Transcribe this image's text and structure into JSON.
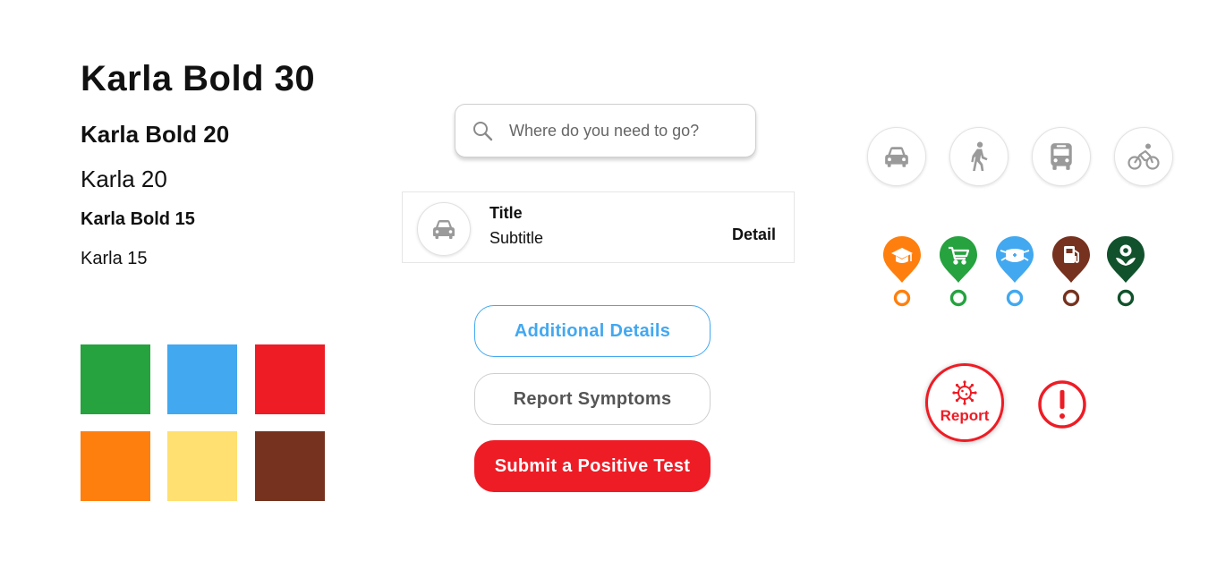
{
  "typography": {
    "karla_bold_30": "Karla Bold 30",
    "karla_bold_20": "Karla Bold 20",
    "karla_20": "Karla 20",
    "karla_bold_15": "Karla Bold 15",
    "karla_15": "Karla 15"
  },
  "swatches": [
    "#26a23f",
    "#42a8f0",
    "#ee1c25",
    "#ff7f0e",
    "#ffe070",
    "#76321f"
  ],
  "search": {
    "placeholder": "Where do you need to go?",
    "icon": "search-icon"
  },
  "list_item": {
    "title": "Title",
    "subtitle": "Subtitle",
    "detail": "Detail",
    "icon": "car-icon"
  },
  "buttons": {
    "additional_details": "Additional Details",
    "report_symptoms": "Report Symptoms",
    "submit_positive_test": "Submit a Positive Test"
  },
  "transport_modes": [
    "car-icon",
    "walk-icon",
    "bus-icon",
    "bike-icon"
  ],
  "pins": [
    {
      "icon": "graduation-cap-icon",
      "color": "#ff7f0e"
    },
    {
      "icon": "shopping-cart-icon",
      "color": "#26a23f"
    },
    {
      "icon": "medical-mask-icon",
      "color": "#42a8f0"
    },
    {
      "icon": "fuel-pump-icon",
      "color": "#76321f"
    },
    {
      "icon": "flower-icon",
      "color": "#11522c"
    }
  ],
  "report": {
    "label": "Report",
    "icon": "virus-icon"
  },
  "colors": {
    "accent_red": "#ee1c25",
    "accent_blue": "#42a8f0",
    "icon_gray": "#9a9a9a"
  }
}
